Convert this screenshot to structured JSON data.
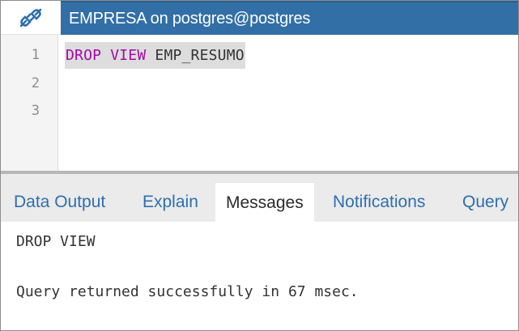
{
  "titlebar": {
    "connection_icon": "connection-link-icon",
    "title": "EMPRESA on postgres@postgres",
    "accent_color": "#326fa6"
  },
  "editor": {
    "line_numbers": [
      "1",
      "2",
      "3"
    ],
    "code": {
      "keyword_1": "DROP",
      "keyword_2": "VIEW",
      "identifier": "EMP_RESUMO"
    },
    "keyword_color": "#a50aa5"
  },
  "tabs": [
    {
      "label": "Data Output",
      "active": false
    },
    {
      "label": "Explain",
      "active": false
    },
    {
      "label": "Messages",
      "active": true
    },
    {
      "label": "Notifications",
      "active": false
    },
    {
      "label": "Query",
      "active": false
    }
  ],
  "messages": {
    "line_1": "DROP VIEW",
    "line_2": "Query returned successfully in 67 msec."
  }
}
